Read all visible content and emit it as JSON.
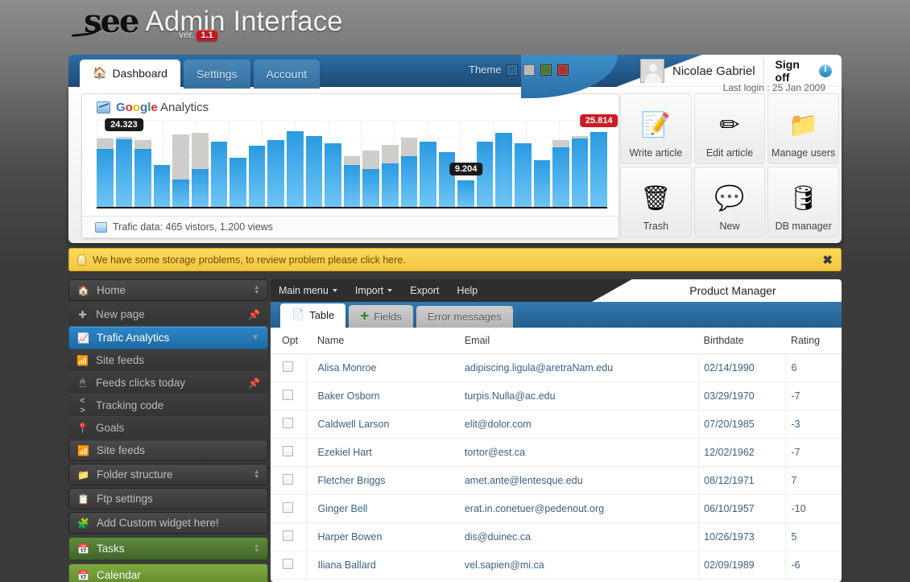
{
  "brand": {
    "mark": "see",
    "title": "Admin Interface",
    "ver_label": "ver.",
    "ver_value": "1.1"
  },
  "topnav": {
    "tabs": [
      {
        "label": "Dashboard",
        "icon": "home-icon",
        "active": true
      },
      {
        "label": "Settings",
        "icon": "",
        "active": false
      },
      {
        "label": "Account",
        "icon": "",
        "active": false
      }
    ],
    "theme_label": "Theme",
    "theme_swatches": [
      "#2a6496",
      "#b8b8b8",
      "#4e7436",
      "#a83232"
    ],
    "user_name": "Nicolae Gabriel",
    "signoff_label": "Sign off",
    "last_login": "Last login : 25 Jan 2009"
  },
  "chart_data": {
    "type": "bar",
    "title": "Google Analytics",
    "title_parts": [
      "G",
      "o",
      "o",
      "g",
      "l",
      "e"
    ],
    "title_suffix": " Analytics",
    "xlabel": "",
    "ylabel": "",
    "ylim": [
      0,
      30000
    ],
    "grid": true,
    "legend": "none",
    "series": [
      {
        "name": "views",
        "color": "#cfcdc9",
        "values": [
          23500,
          24323,
          23000,
          14500,
          25000,
          25500,
          22500,
          17000,
          21000,
          23000,
          26000,
          24500,
          22000,
          17500,
          19500,
          21500,
          24000,
          22500,
          19000,
          9204,
          22500,
          25500,
          22000,
          16000,
          23000,
          24500,
          25814
        ]
      },
      {
        "name": "vistors",
        "color": "#2a9ae1",
        "values": [
          20000,
          23400,
          20000,
          14500,
          9500,
          13000,
          22500,
          17000,
          21000,
          23000,
          26000,
          24500,
          22000,
          14500,
          13000,
          15000,
          17500,
          22500,
          19000,
          9204,
          22500,
          25500,
          22000,
          16000,
          20500,
          23500,
          25814
        ]
      }
    ],
    "annotations": [
      {
        "label": "24.323",
        "style": "dark",
        "index": 1
      },
      {
        "label": "9.204",
        "style": "dark",
        "index": 19
      },
      {
        "label": "25.814",
        "style": "red",
        "index": 26
      }
    ],
    "footer": "Trafic data: 465 vistors, 1.200 views",
    "footer_parts": {
      "prefix": "Trafic data:",
      "visitors": "465",
      "visitors_label": "vistors,",
      "views": "1.200",
      "views_label": "views"
    }
  },
  "tiles": [
    {
      "label": "Write article",
      "icon": "note-add-icon",
      "glyph": "📝"
    },
    {
      "label": "Edit article",
      "icon": "note-edit-icon",
      "glyph": "✏"
    },
    {
      "label": "Manage users",
      "icon": "folder-users-icon",
      "glyph": "📁"
    },
    {
      "label": "Trash",
      "icon": "trash-icon",
      "glyph": "🗑"
    },
    {
      "label": "New",
      "icon": "comment-new-icon",
      "glyph": "💬"
    },
    {
      "label": "DB manager",
      "icon": "database-icon",
      "glyph": "🛢"
    }
  ],
  "notice": {
    "text": "We have some storage problems, to review problem please click here.",
    "icon": "bulb-icon",
    "close": "✖"
  },
  "sidebar": {
    "items": [
      {
        "label": "Home",
        "icon": "home-icon",
        "glyph": "🏠",
        "type": "group",
        "right": "stepper"
      },
      {
        "label": "New page",
        "icon": "plus-icon",
        "glyph": "✚",
        "type": "plain",
        "right": "pin"
      },
      {
        "label": "Trafic Analytics",
        "icon": "chart-icon",
        "glyph": "📈",
        "type": "active",
        "right": "chevron"
      },
      {
        "label": "Site feeds",
        "icon": "rss-icon",
        "glyph": "📶",
        "type": "plain",
        "right": ""
      },
      {
        "label": "Feeds clicks today",
        "icon": "mouse-icon",
        "glyph": "🖱",
        "type": "plain",
        "right": "pin"
      },
      {
        "label": "Tracking code",
        "icon": "code-icon",
        "glyph": "< >",
        "type": "plain",
        "right": ""
      },
      {
        "label": "Goals",
        "icon": "pin-marker-icon",
        "glyph": "📍",
        "type": "plain",
        "right": ""
      },
      {
        "label": "Site feeds",
        "icon": "rss-icon",
        "glyph": "📶",
        "type": "group",
        "right": ""
      },
      {
        "label": "Folder structure",
        "icon": "folder-icon",
        "glyph": "📁",
        "type": "group",
        "right": "stepper"
      },
      {
        "label": "Ftp settings",
        "icon": "ftp-icon",
        "glyph": "📋",
        "type": "group",
        "right": ""
      },
      {
        "label": "Add Custom widget here!",
        "icon": "puzzle-icon",
        "glyph": "🧩",
        "type": "group",
        "right": ""
      },
      {
        "label": "Tasks",
        "icon": "calendar-check-icon",
        "glyph": "📅",
        "type": "greenb",
        "right": "stepper"
      },
      {
        "label": "Calendar",
        "icon": "calendar-icon",
        "glyph": "📅",
        "type": "green2",
        "right": ""
      }
    ]
  },
  "content": {
    "menu": [
      {
        "label": "Main menu",
        "has_caret": true
      },
      {
        "label": "Import",
        "has_caret": true
      },
      {
        "label": "Export",
        "has_caret": false
      },
      {
        "label": "Help",
        "has_caret": false
      }
    ],
    "title": "Product Manager",
    "tabs": [
      {
        "label": "Table",
        "icon": "pages-icon",
        "glyph": "📄",
        "active": true
      },
      {
        "label": "Fields",
        "icon": "plus-green-icon",
        "glyph": "✚",
        "active": false
      },
      {
        "label": "Error messages",
        "icon": "",
        "glyph": "",
        "active": false
      }
    ],
    "table": {
      "columns": [
        "Opt",
        "Name",
        "Email",
        "Birthdate",
        "Rating"
      ],
      "rows": [
        {
          "name": "Alisa Monroe",
          "email": "adipiscing.ligula@aretraNam.edu",
          "birthdate": "02/14/1990",
          "rating": "6"
        },
        {
          "name": "Baker Osborn",
          "email": "turpis.Nulla@ac.edu",
          "birthdate": "03/29/1970",
          "rating": "-7"
        },
        {
          "name": "Caldwell Larson",
          "email": "elit@dolor.com",
          "birthdate": "07/20/1985",
          "rating": "-3"
        },
        {
          "name": "Ezekiel Hart",
          "email": "tortor@est.ca",
          "birthdate": "12/02/1962",
          "rating": "-7"
        },
        {
          "name": "Fletcher Briggs",
          "email": "amet.ante@lentesque.edu",
          "birthdate": "08/12/1971",
          "rating": "7"
        },
        {
          "name": "Ginger Bell",
          "email": "erat.in.conetuer@pedenout.org",
          "birthdate": "06/10/1957",
          "rating": "-10"
        },
        {
          "name": "Harper Bowen",
          "email": "dis@duinec.ca",
          "birthdate": "10/26/1973",
          "rating": "5"
        },
        {
          "name": "Iliana Ballard",
          "email": "vel.sapien@mi.ca",
          "birthdate": "02/09/1989",
          "rating": "-6"
        }
      ]
    }
  }
}
